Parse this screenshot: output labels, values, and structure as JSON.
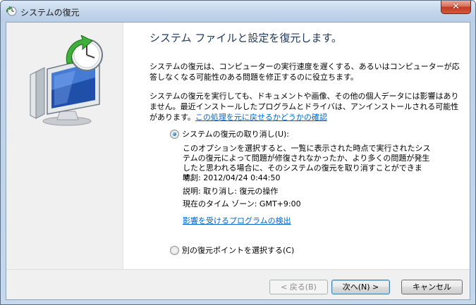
{
  "window": {
    "title": "システムの復元",
    "close_label": "✕"
  },
  "main": {
    "heading": "システム ファイルと設定を復元します。",
    "para1": "システムの復元は、コンピューターの実行速度を遅くする、あるいはコンピューターが応答しなくなる可能性のある問題を修正するのに役立ちます。",
    "para2": "システムの復元を実行しても、ドキュメントや画像、その他の個人データには影響はありません。最近インストールしたプログラムとドライバは、アンインストールされる可能性があります。",
    "para2_link": "この処理を元に戻せるかどうかの確認"
  },
  "options": {
    "undo": {
      "label": "システムの復元の取り消し(U):",
      "checked": true,
      "description": "このオプションを選択すると、一覧に表示された時点で実行されたシステムの復元によって問題が修復されなかったか、より多くの問題が発生したと思われる場合に、そのシステムの復元を取り消すことができます。",
      "time": "時刻: 2012/04/24 0:44:50",
      "desc": "説明: 取り消し: 復元の操作",
      "timezone": "現在のタイム ゾーン: GMT+9:00",
      "affected_link": "影響を受けるプログラムの検出"
    },
    "other": {
      "label": "別の復元ポイントを選択する(C)",
      "checked": false
    }
  },
  "buttons": {
    "back": "< 戻る(B)",
    "next": "次へ(N) >",
    "cancel": "キャンセル"
  },
  "icons": {
    "title": "system-restore-icon",
    "side": "system-restore-monitor-clock-icon"
  }
}
